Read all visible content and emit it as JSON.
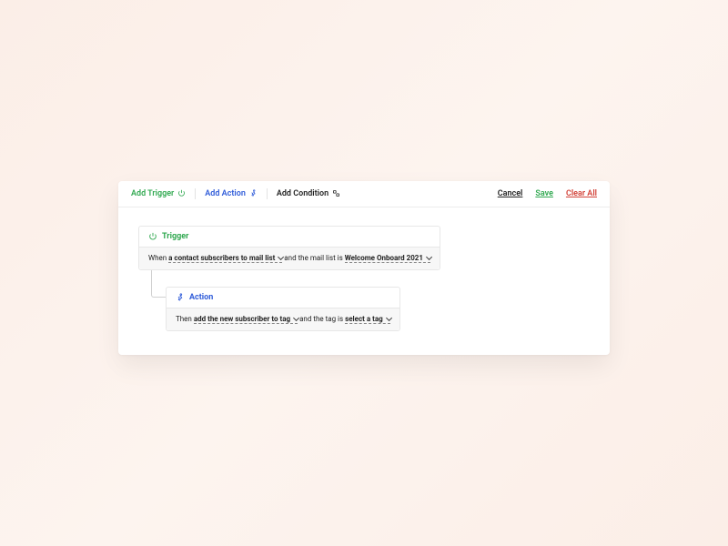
{
  "toolbar": {
    "add_trigger": "Add Trigger",
    "add_action": "Add Action",
    "add_condition": "Add Condition",
    "cancel": "Cancel",
    "save": "Save",
    "clear_all": "Clear All"
  },
  "trigger": {
    "heading": "Trigger",
    "prefix": "When",
    "event": "a contact subscribers to mail list",
    "middle": "and the mail list is",
    "value": "Welcome Onboard 2021"
  },
  "action": {
    "heading": "Action",
    "prefix": "Then",
    "event": "add the new subscriber to tag",
    "middle": "and the tag is",
    "value": "select a tag"
  },
  "colors": {
    "green": "#2fa84f",
    "blue": "#2e5bd9",
    "red": "#d24137"
  },
  "icons": {
    "trigger": "power-icon",
    "action": "running-icon",
    "condition": "condition-icon"
  }
}
